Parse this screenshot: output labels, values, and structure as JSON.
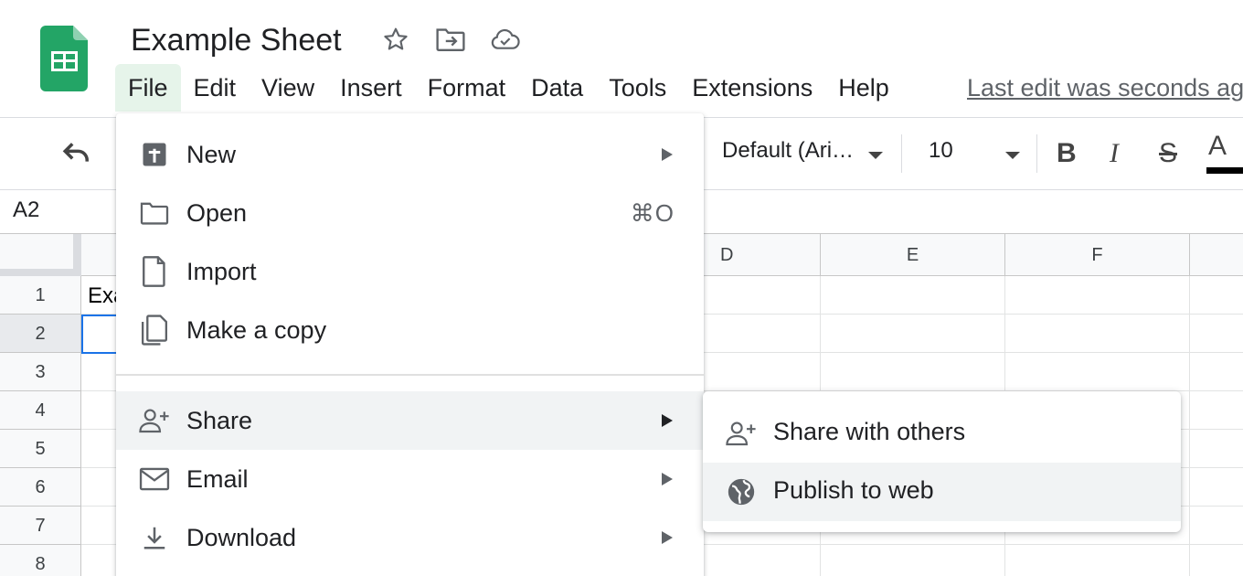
{
  "document": {
    "title": "Example Sheet",
    "last_edit": "Last edit was seconds ago"
  },
  "colors": {
    "sheets_green": "#23a566",
    "selection_blue": "#1a73e8",
    "menu_hover": "#f1f3f4",
    "active_menu": "#e6f4ea"
  },
  "menubar": {
    "items": [
      "File",
      "Edit",
      "View",
      "Insert",
      "Format",
      "Data",
      "Tools",
      "Extensions",
      "Help"
    ],
    "active": "File"
  },
  "toolbar": {
    "font": "Default (Ari…",
    "font_size": "10",
    "bold": "B",
    "italic": "I",
    "strike": "S",
    "text_color": "A"
  },
  "formula_bar": {
    "name_box": "A2"
  },
  "grid": {
    "columns": [
      "D",
      "E",
      "F"
    ],
    "rows": [
      "1",
      "2",
      "3",
      "4",
      "5",
      "6",
      "7",
      "8"
    ],
    "selected_row": "2",
    "cell_a1": "Example"
  },
  "file_menu": {
    "items": [
      {
        "label": "New",
        "icon": "new-sheet-icon",
        "submenu": true
      },
      {
        "label": "Open",
        "icon": "folder-icon",
        "shortcut": "⌘O"
      },
      {
        "label": "Import",
        "icon": "file-icon"
      },
      {
        "label": "Make a copy",
        "icon": "copy-icon"
      },
      {
        "label": "Share",
        "icon": "person-add-icon",
        "submenu": true,
        "highlighted": true
      },
      {
        "label": "Email",
        "icon": "mail-icon",
        "submenu": true
      },
      {
        "label": "Download",
        "icon": "download-icon",
        "submenu": true
      }
    ]
  },
  "share_submenu": {
    "items": [
      {
        "label": "Share with others",
        "icon": "person-add-icon"
      },
      {
        "label": "Publish to web",
        "icon": "globe-icon",
        "highlighted": true
      }
    ]
  }
}
